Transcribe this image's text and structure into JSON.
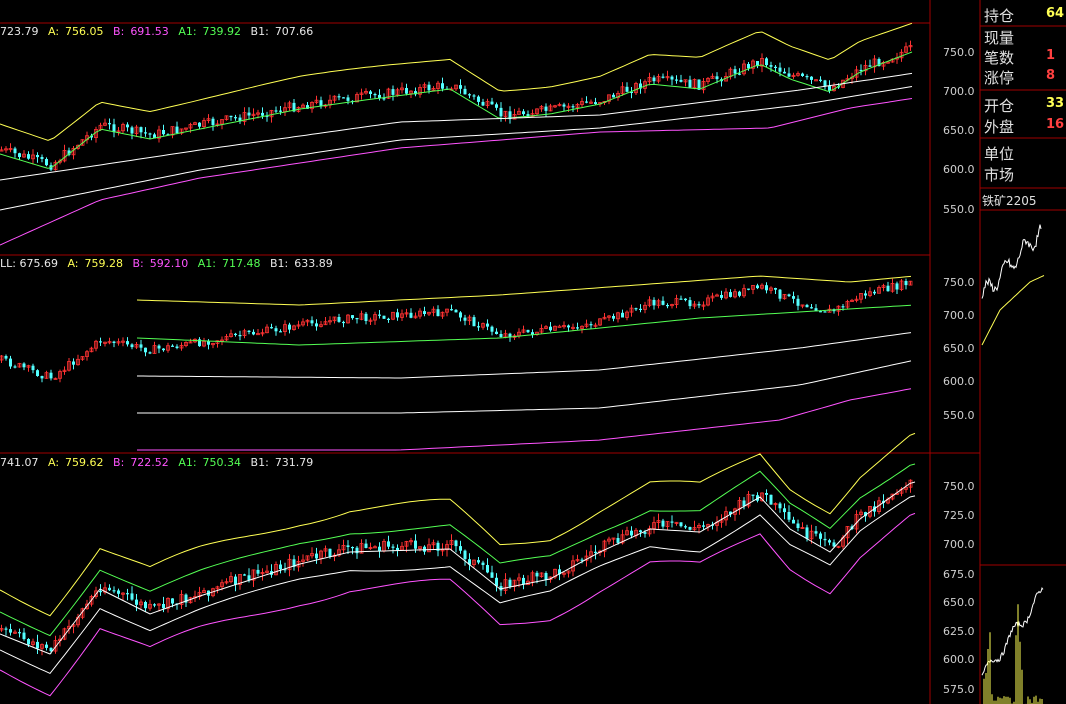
{
  "panels": [
    {
      "id": "p1",
      "info": {
        "base": "723.79",
        "a_label": "A:",
        "a": "756.05",
        "b_label": "B:",
        "b": "691.53",
        "a1_label": "A1:",
        "a1": "739.92",
        "b1_label": "B1:",
        "b1": "707.66"
      },
      "y_ticks": [
        "750.0",
        "700.0",
        "650.0",
        "600.0",
        "550.0"
      ]
    },
    {
      "id": "p2",
      "info": {
        "base": "LL: 675.69",
        "a_label": "A:",
        "a": "759.28",
        "b_label": "B:",
        "b": "592.10",
        "a1_label": "A1:",
        "a1": "717.48",
        "b1_label": "B1:",
        "b1": "633.89"
      },
      "y_ticks": [
        "750.0",
        "700.0",
        "650.0",
        "600.0",
        "550.0"
      ]
    },
    {
      "id": "p3",
      "info": {
        "base": "741.07",
        "a_label": "A:",
        "a": "759.62",
        "b_label": "B:",
        "b": "722.52",
        "a1_label": "A1:",
        "a1": "750.34",
        "b1_label": "B1:",
        "b1": "731.79"
      },
      "y_ticks": [
        "750.0",
        "725.0",
        "700.0",
        "675.0",
        "650.0",
        "625.0",
        "600.0",
        "575.0"
      ]
    }
  ],
  "side_panel": {
    "rows1": [
      {
        "label": "持仓",
        "value": "64",
        "color": "v-y"
      },
      {
        "label": "现量",
        "value": "",
        "color": "v-w"
      },
      {
        "label": "笔数",
        "value": "1",
        "color": "v-r"
      },
      {
        "label": "涨停",
        "value": "8",
        "color": "v-r"
      }
    ],
    "rows2": [
      {
        "label": "开仓",
        "value": "33",
        "color": "v-y"
      },
      {
        "label": "外盘",
        "value": "16",
        "color": "v-r"
      }
    ],
    "rows3": [
      {
        "label": "单位",
        "value": "",
        "color": "v-w"
      },
      {
        "label": "市场",
        "value": "",
        "color": "v-w"
      }
    ],
    "contract": "铁矿2205"
  },
  "colors": {
    "bull": "#ff3232",
    "bear": "#54ffff",
    "yellow": "#ffff54",
    "green": "#54ff54",
    "white": "#ffffff",
    "magenta": "#ff54ff",
    "border": "#a00000"
  },
  "chart_data": [
    {
      "type": "candlestick",
      "panel": "p1",
      "ylim": [
        510,
        775
      ],
      "bands": [
        "A",
        "A1",
        "mid",
        "B1",
        "B"
      ]
    },
    {
      "type": "candlestick",
      "panel": "p2",
      "ylim": [
        510,
        775
      ],
      "bands": [
        "A",
        "A1",
        "B1",
        "B"
      ]
    },
    {
      "type": "candlestick",
      "panel": "p3",
      "ylim": [
        570,
        770
      ],
      "bands": [
        "A",
        "A1",
        "mid",
        "B1",
        "B"
      ]
    }
  ]
}
